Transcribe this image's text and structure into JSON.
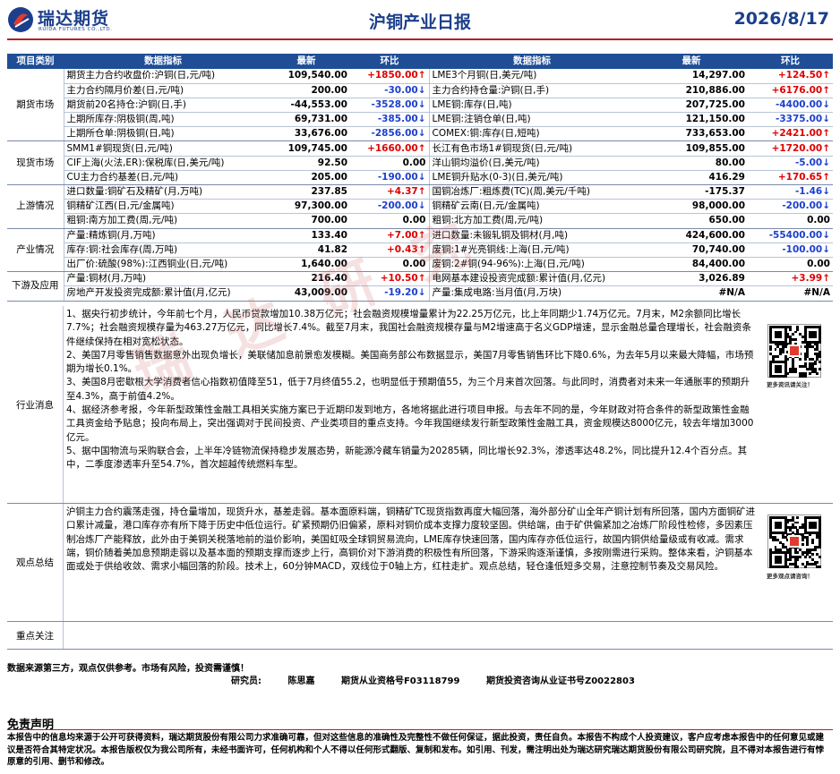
{
  "header": {
    "company_cn": "瑞达期货",
    "company_en": "RUIDA FUTURES CO.,LTD.",
    "title": "沪铜产业日报",
    "date": "2026/8/17"
  },
  "columns": {
    "category": "项目类别",
    "indicator": "数据指标",
    "latest": "最新",
    "change": "环比"
  },
  "groups": [
    {
      "category": "期货市场",
      "rows": [
        {
          "l": {
            "name": "期货主力合约收盘价:沪铜(日,元/吨)",
            "val": "109,540.00",
            "chg": "+1850.00↑",
            "dir": "up"
          },
          "r": {
            "name": "LME3个月铜(日,美元/吨)",
            "val": "14,297.00",
            "chg": "+124.50↑",
            "dir": "up"
          }
        },
        {
          "l": {
            "name": "主力合约隔月价差(日,元/吨)",
            "val": "200.00",
            "chg": "-30.00↓",
            "dir": "down"
          },
          "r": {
            "name": " 主力合约持仓量:沪铜(日,手)",
            "val": "210,886.00",
            "chg": "+6176.00↑",
            "dir": "up"
          }
        },
        {
          "l": {
            "name": "期货前20名持仓:沪铜(日,手)",
            "val": "-44,553.00",
            "chg": "-3528.00↓",
            "dir": "down"
          },
          "r": {
            "name": "LME铜:库存(日,吨)",
            "val": "207,725.00",
            "chg": "-4400.00↓",
            "dir": "down"
          }
        },
        {
          "l": {
            "name": "上期所库存:阴极铜(周,吨)",
            "val": "69,731.00",
            "chg": "-385.00↓",
            "dir": "down"
          },
          "r": {
            "name": "LME铜:注销仓单(日,吨)",
            "val": "121,150.00",
            "chg": "-3375.00↓",
            "dir": "down"
          }
        },
        {
          "l": {
            "name": "上期所仓单:阴极铜(日,吨)",
            "val": "33,676.00",
            "chg": "-2856.00↓",
            "dir": "down"
          },
          "r": {
            "name": "COMEX:铜:库存(日,短吨)",
            "val": "733,653.00",
            "chg": "+2421.00↑",
            "dir": "up"
          }
        }
      ]
    },
    {
      "category": "现货市场",
      "rows": [
        {
          "l": {
            "name": "SMM1#铜现货(日,元/吨)",
            "val": "109,745.00",
            "chg": "+1660.00↑",
            "dir": "up"
          },
          "r": {
            "name": "长江有色市场1#铜现货(日,元/吨)",
            "val": "109,855.00",
            "chg": "+1720.00↑",
            "dir": "up"
          }
        },
        {
          "l": {
            "name": "CIF上海(火法,ER):保税库(日,美元/吨)",
            "val": "92.50",
            "chg": "0.00",
            "dir": "flat"
          },
          "r": {
            "name": "洋山铜均溢价(日,美元/吨)",
            "val": "80.00",
            "chg": "-5.00↓",
            "dir": "down"
          }
        },
        {
          "l": {
            "name": "CU主力合约基差(日,元/吨)",
            "val": "205.00",
            "chg": "-190.00↓",
            "dir": "down"
          },
          "r": {
            "name": "LME铜升贴水(0-3)(日,美元/吨)",
            "val": "416.29",
            "chg": "+170.65↑",
            "dir": "up"
          }
        }
      ]
    },
    {
      "category": "上游情况",
      "rows": [
        {
          "l": {
            "name": "进口数量:铜矿石及精矿(月,万吨)",
            "val": "237.85",
            "chg": "+4.37↑",
            "dir": "up"
          },
          "r": {
            "name": "国铜冶炼厂:粗炼费(TC)(周,美元/千吨)",
            "val": "-175.37",
            "chg": "-1.46↓",
            "dir": "down"
          }
        },
        {
          "l": {
            "name": "铜精矿江西(日,元/金属吨)",
            "val": "97,300.00",
            "chg": "-200.00↓",
            "dir": "down"
          },
          "r": {
            "name": "铜精矿云南(日,元/金属吨)",
            "val": "98,000.00",
            "chg": "-200.00↓",
            "dir": "down"
          }
        },
        {
          "l": {
            "name": "粗铜:南方加工费(周,元/吨)",
            "val": "700.00",
            "chg": "0.00",
            "dir": "flat"
          },
          "r": {
            "name": "粗铜:北方加工费(周,元/吨)",
            "val": "650.00",
            "chg": "0.00",
            "dir": "flat"
          }
        }
      ]
    },
    {
      "category": "产业情况",
      "rows": [
        {
          "l": {
            "name": "产量:精炼铜(月,万吨)",
            "val": "133.40",
            "chg": "+7.00↑",
            "dir": "up"
          },
          "r": {
            "name": "进口数量:未锻轧铜及铜材(月,吨)",
            "val": "424,600.00",
            "chg": "-55400.00↓",
            "dir": "down"
          }
        },
        {
          "l": {
            "name": "库存:铜:社会库存(周,万吨)",
            "val": "41.82",
            "chg": "+0.43↑",
            "dir": "up"
          },
          "r": {
            "name": "废铜:1#光亮铜线:上海(日,元/吨)",
            "val": "70,740.00",
            "chg": "-100.00↓",
            "dir": "down"
          }
        },
        {
          "l": {
            "name": "出厂价:硫酸(98%):江西铜业(日,元/吨)",
            "val": "1,640.00",
            "chg": "0.00",
            "dir": "flat"
          },
          "r": {
            "name": "废铜:2#铜(94-96%):上海(日,元/吨)",
            "val": "84,400.00",
            "chg": "0.00",
            "dir": "flat"
          }
        }
      ]
    },
    {
      "category": "下游及应用",
      "rows": [
        {
          "l": {
            "name": "产量:铜材(月,万吨)",
            "val": "216.40",
            "chg": "+10.50↑",
            "dir": "up"
          },
          "r": {
            "name": "电网基本建设投资完成额:累计值(月,亿元)",
            "val": "3,026.89",
            "chg": "+3.99↑",
            "dir": "up"
          }
        },
        {
          "l": {
            "name": "房地产开发投资完成额:累计值(月,亿元)",
            "val": "43,009.00",
            "chg": "-19.20↓",
            "dir": "down"
          },
          "r": {
            "name": "产量:集成电路:当月值(月,万块)",
            "val": "#N/A",
            "chg": "#N/A",
            "dir": "flat"
          }
        }
      ]
    }
  ],
  "news": {
    "label": "行业消息",
    "items": [
      "1、据央行初步统计，今年前七个月，人民币贷款增加10.38万亿元；社会融资规模增量累计为22.25万亿元，比上年同期少1.74万亿元。7月末，M2余额同比增长7.7%；社会融资规模存量为463.27万亿元，同比增长7.4%。截至7月末，我国社会融资规模存量与M2增速高于名义GDP增速，显示金融总量合理增长，社会融资条件继续保持在相对宽松状态。",
      "2、美国7月零售销售数据意外出现负增长，美联储加息前景愈发模糊。美国商务部公布数据显示，美国7月零售销售环比下降0.6%，为去年5月以来最大降幅，市场预期为增长0.1%。",
      "3、美国8月密歇根大学消费者信心指数初值降至51，低于7月终值55.2，也明显低于预期值55，为三个月来首次回落。与此同时，消费者对未来一年通胀率的预期升至4.3%，高于前值4.2%。",
      "4、据经济参考报，今年新型政策性金融工具相关实施方案已于近期印发到地方，各地将据此进行项目申报。与去年不同的是，今年财政对符合条件的新型政策性金融工具资金给予贴息；投向布局上，突出强调对于民间投资、产业类项目的重点支持。今年我国继续发行新型政策性金融工具，资金规模达8000亿元，较去年增加3000亿元。",
      "5、据中国物流与采购联合会，上半年冷链物流保持稳步发展态势，新能源冷藏车销量为20285辆，同比增长92.3%，渗透率达48.2%，同比提升12.4个百分点。其中，二季度渗透率升至54.7%，首次超越传统燃料车型。"
    ],
    "qr_caption": "更多资讯请关注！"
  },
  "view": {
    "label": "观点总结",
    "text": "沪铜主力合约震荡走强，持仓量增加，现货升水，基差走弱。基本面原料端，铜精矿TC现货指数再度大幅回落，海外部分矿山全年产铜计划有所回落，国内方面铜矿进口累计减量，港口库存亦有所下降于历史中低位运行。矿紧预期仍旧偏紧，原料对铜价成本支撑力度较坚固。供给端，由于矿供偏紧加之冶炼厂阶段性检修，多因素压制冶炼厂产能释放，此外由于美铜关税落地前的溢价影响，美国虹吸全球铜贸易流向，LME库存快速回落，国内库存亦低位运行，故国内铜供给量级或有收减。需求端，铜价随着美加息预期走弱以及基本面的预期支撑而逐步上行，高铜价对下游消费的积极性有所回落，下游采购逐渐谨慎，多按刚需进行采购。整体来看，沪铜基本面或处于供给收敛、需求小幅回落的阶段。技术上，60分钟MACD，双线位于0轴上方，红柱走扩。观点总结，轻仓逢低短多交易，注意控制节奏及交易风险。",
    "qr_caption": "更多观点请咨询！"
  },
  "focus": {
    "label": "重点关注",
    "text": ""
  },
  "footer": {
    "source_note": "数据来源第三方，观点仅供参考。市场有风险，投资需谨慎！",
    "researcher_label": "研究员:",
    "researcher_name": "陈思嘉",
    "license_1": "期货从业资格号F03118799",
    "license_2": "期货投资咨询从业证书号Z0022803",
    "disclaimer_title": "免责声明",
    "disclaimer_text": "本报告中的信息均来源于公开可获得资料，瑞达期货股份有限公司力求准确可靠，但对这些信息的准确性及完整性不做任何保证，据此投资，责任自负。本报告不构成个人投资建议，客户应考虑本报告中的任何意见或建议是否符合其特定状况。本报告版权仅为我公司所有，未经书面许可，任何机构和个人不得以任何形式翻版、复制和发布。如引用、刊发，需注明出处为瑞达研究瑞达期货股份有限公司研究院，且不得对本报告进行有悖原意的引用、删节和修改。"
  },
  "watermark": "瑞达研究",
  "colors": {
    "brand_blue": "#1b3f8b",
    "header_bar": "#1f4e96",
    "up": "#e00000",
    "down": "#1d3fcf",
    "rule_red": "#b22222"
  }
}
